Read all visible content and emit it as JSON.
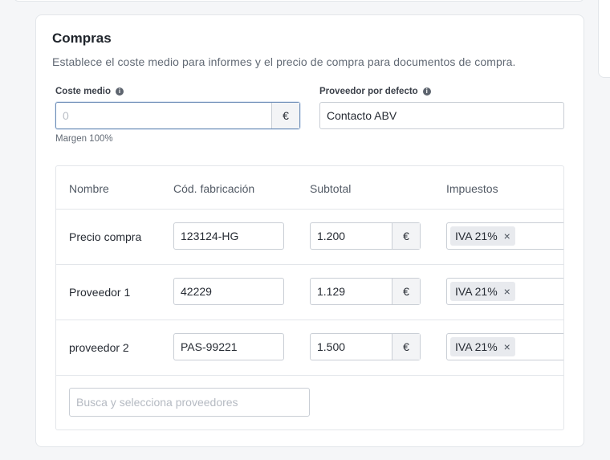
{
  "section": {
    "title": "Compras",
    "description": "Establece el coste medio para informes y el precio de compra para documentos de compra."
  },
  "coste_medio": {
    "label": "Coste medio",
    "placeholder": "0",
    "currency": "€",
    "hint": "Margen 100%"
  },
  "proveedor": {
    "label": "Proveedor por defecto",
    "value": "Contacto ABV"
  },
  "table": {
    "headers": [
      "Nombre",
      "Cód. fabricación",
      "Subtotal",
      "Impuestos"
    ],
    "rows": [
      {
        "name": "Precio compra",
        "code": "123124-HG",
        "subtotal": "1.200",
        "currency": "€",
        "tax": "IVA 21%"
      },
      {
        "name": "Proveedor 1",
        "code": "42229",
        "subtotal": "1.129",
        "currency": "€",
        "tax": "IVA 21%"
      },
      {
        "name": "proveedor 2",
        "code": "PAS-99221",
        "subtotal": "1.500",
        "currency": "€",
        "tax": "IVA 21%"
      }
    ],
    "remove_glyph": "×",
    "search_placeholder": "Busca y selecciona proveedores"
  },
  "icons": {
    "info": "info-icon",
    "remove": "close-icon"
  }
}
